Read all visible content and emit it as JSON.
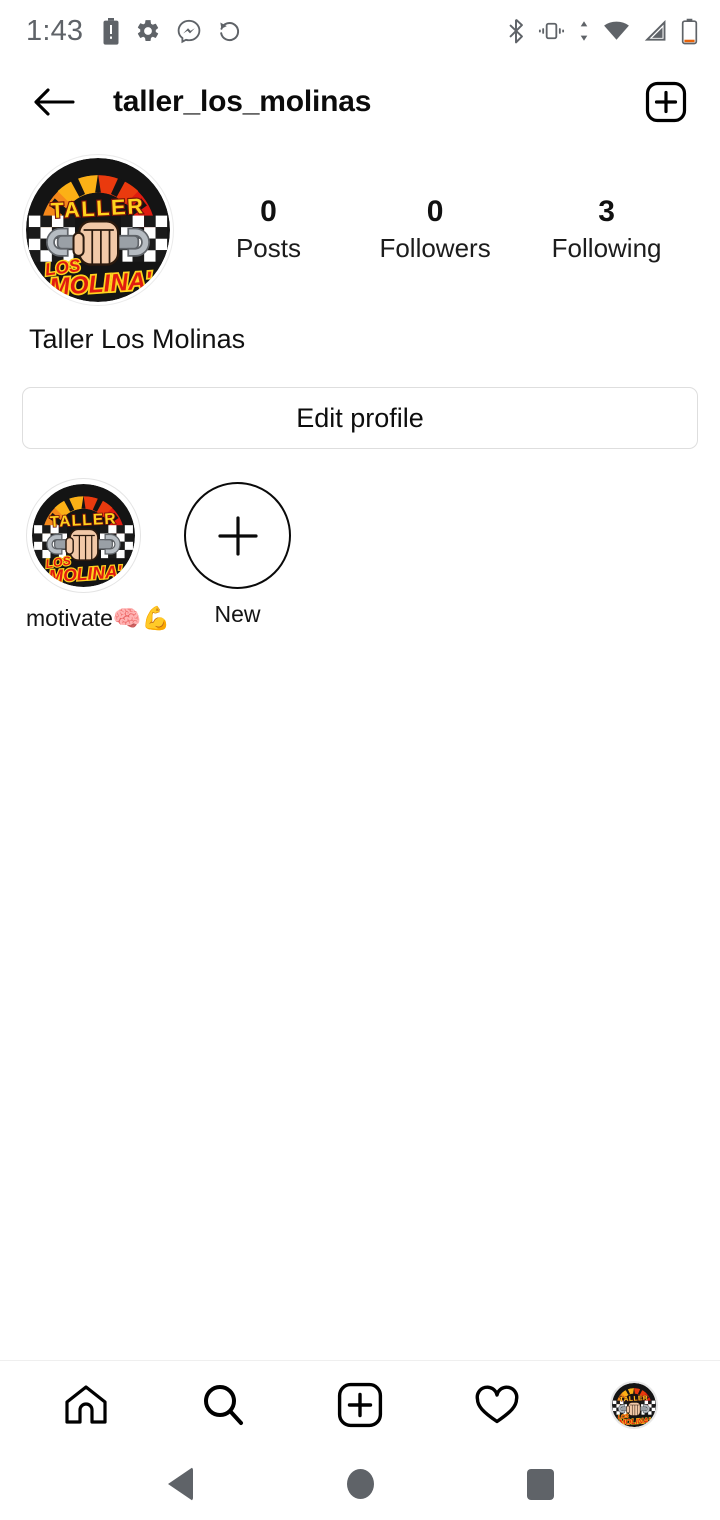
{
  "status_bar": {
    "time": "1:43",
    "left_icons": [
      "battery-alert-icon",
      "gear-icon",
      "messenger-icon",
      "history-icon"
    ],
    "right_icons": [
      "bluetooth-icon",
      "vibrate-icon",
      "data-transfer-icon",
      "wifi-icon",
      "signal-icon",
      "battery-icon"
    ]
  },
  "header": {
    "back_label": "back-arrow",
    "title": "taller_los_molinas",
    "add_label": "add-post"
  },
  "profile": {
    "avatar_alt": "Taller Los Molinas logo",
    "display_name": "Taller Los Molinas",
    "stats": [
      {
        "value": "0",
        "label": "Posts"
      },
      {
        "value": "0",
        "label": "Followers"
      },
      {
        "value": "3",
        "label": "Following"
      }
    ],
    "edit_button": "Edit profile"
  },
  "highlights": [
    {
      "label": "motivate🧠💪",
      "type": "story"
    },
    {
      "label": "New",
      "type": "new"
    }
  ],
  "bottom_nav": [
    {
      "name": "home",
      "icon": "home-icon"
    },
    {
      "name": "search",
      "icon": "search-icon"
    },
    {
      "name": "create",
      "icon": "plus-square-icon"
    },
    {
      "name": "activity",
      "icon": "heart-icon"
    },
    {
      "name": "profile",
      "icon": "profile-avatar"
    }
  ],
  "android_nav": [
    {
      "name": "back",
      "icon": "triangle-back-icon"
    },
    {
      "name": "home",
      "icon": "circle-home-icon"
    },
    {
      "name": "recents",
      "icon": "square-recents-icon"
    }
  ],
  "colors": {
    "text_primary": "#111111",
    "status_grey": "#5f6368",
    "border": "#dedede",
    "logo_red": "#d81f12",
    "logo_orange": "#f07c18",
    "logo_yellow": "#ffd21e",
    "logo_dark": "#151515"
  }
}
